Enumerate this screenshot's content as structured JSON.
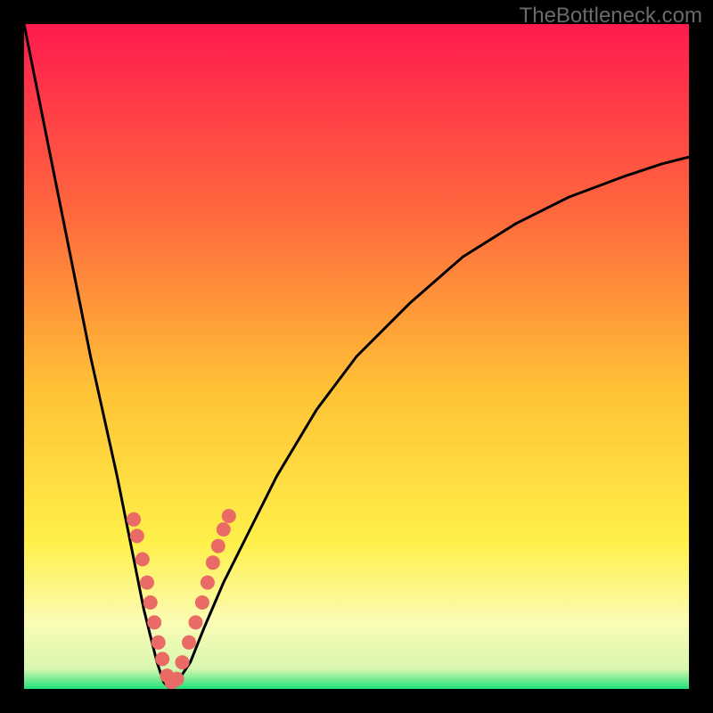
{
  "watermark": "TheBottleneck.com",
  "colors": {
    "gradient_top": "#ff1a4e",
    "gradient_mid_upper": "#ff6d3d",
    "gradient_mid": "#ffc236",
    "gradient_lower": "#fff04a",
    "gradient_pale": "#fbfcb5",
    "gradient_green": "#1ee07a",
    "curve": "#000000",
    "marker": "#ea6a66",
    "frame": "#000000"
  },
  "chart_data": {
    "type": "line",
    "title": "",
    "xlabel": "",
    "ylabel": "",
    "xlim": [
      0,
      100
    ],
    "ylim": [
      0,
      100
    ],
    "note": "X axis = relative component score (0–100). Y axis = bottleneck percentage (0 = balanced, 100 = fully bottlenecked). Values estimated from pixel positions.",
    "series": [
      {
        "name": "bottleneck-curve",
        "x": [
          0,
          2,
          4,
          6,
          8,
          10,
          12,
          14,
          16,
          18,
          19,
          20,
          21,
          22,
          23,
          25,
          27,
          30,
          34,
          38,
          44,
          50,
          58,
          66,
          74,
          82,
          90,
          96,
          100
        ],
        "values": [
          100,
          90,
          80,
          70,
          60,
          50,
          41,
          32,
          22,
          12,
          8,
          4,
          1,
          0,
          1,
          4,
          9,
          16,
          24,
          32,
          42,
          50,
          58,
          65,
          70,
          74,
          77,
          79,
          80
        ]
      }
    ],
    "markers": {
      "name": "highlighted-points",
      "x": [
        16.5,
        17.0,
        17.8,
        18.5,
        19.0,
        19.6,
        20.2,
        20.8,
        21.5,
        22.2,
        23.0,
        23.8,
        24.8,
        25.8,
        26.8,
        27.6,
        28.4,
        29.2,
        30.0,
        30.8
      ],
      "values": [
        25.5,
        23.0,
        19.5,
        16.0,
        13.0,
        10.0,
        7.0,
        4.5,
        2.0,
        1.0,
        1.5,
        4.0,
        7.0,
        10.0,
        13.0,
        16.0,
        19.0,
        21.5,
        24.0,
        26.0
      ]
    }
  }
}
